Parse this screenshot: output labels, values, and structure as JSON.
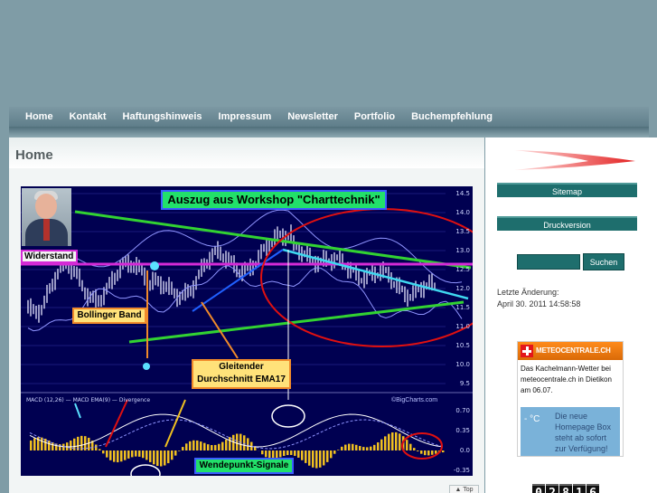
{
  "nav": {
    "items": [
      "Home",
      "Kontakt",
      "Haftungshinweis",
      "Impressum",
      "Newsletter",
      "Portfolio",
      "Buchempfehlung"
    ]
  },
  "main": {
    "title": "Home",
    "top_label": "▲ Top"
  },
  "chart": {
    "title": "Auszug aus Workshop \"Charttechnik\"",
    "labels": {
      "widerstand": "Widerstand",
      "bollinger": "Bollinger Band",
      "ema_line1": "Gleitender",
      "ema_line2": "Durchschnitt EMA17",
      "wendepunkt": "Wendepunkt-Signale"
    },
    "macd_legend": "MACD (12,26)  — MACD EMA(9)  — Divergence",
    "source": "©BigCharts.com",
    "y_ticks": [
      "14.5",
      "14.0",
      "13.5",
      "13.0",
      "12.5",
      "12.0",
      "11.5",
      "11.0",
      "10.5",
      "10.0",
      "9.5"
    ],
    "macd_ticks": [
      "0.70",
      "0.35",
      "0.0",
      "-0.35"
    ]
  },
  "sidebar": {
    "sitemap": "Sitemap",
    "druck": "Druckversion",
    "search_button": "Suchen",
    "search_value": "",
    "update_label": "Letzte Änderung:",
    "update_value": "April 30. 2011 14:58:58",
    "meteo": {
      "brand": "METEOCENTRALE.CH",
      "text": "Das Kachelmann-Wetter bei meteocentrale.ch in Dietikon am 06.07.",
      "temp": "- °C",
      "news": "Die neue Homepage Box steht ab sofort zur Verfügung!"
    },
    "counter": [
      "0",
      "2",
      "8",
      "1",
      "6"
    ]
  }
}
